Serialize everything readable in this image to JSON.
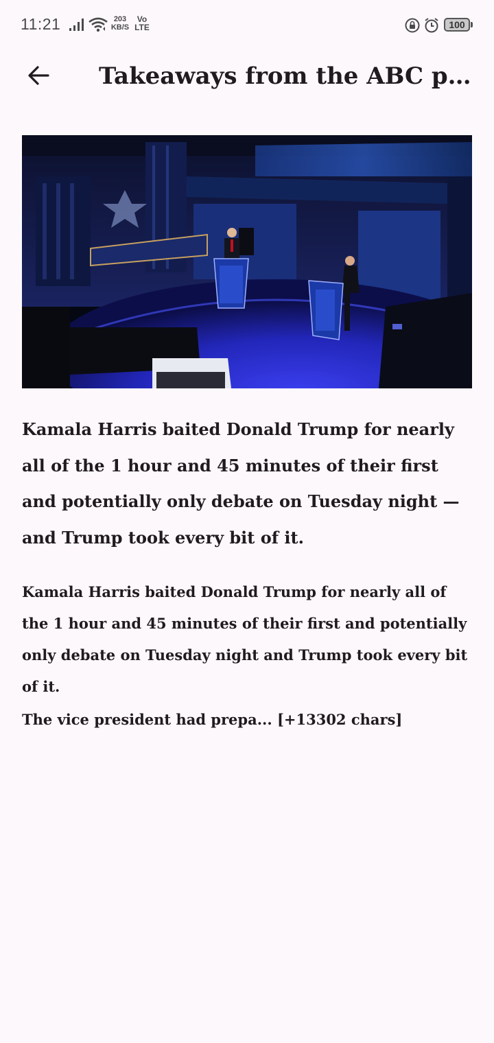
{
  "status_bar": {
    "time": "11:21",
    "net_speed_value": "203",
    "net_speed_unit": "KB/S",
    "volte_top": "Vo",
    "volte_bottom": "LTE",
    "battery": "100"
  },
  "header": {
    "title": "Takeaways from the ABC pr…",
    "back_icon": "arrow-left-icon"
  },
  "article": {
    "image_alt": "Debate stage with two candidates at podiums",
    "lead": "Kamala Harris baited Donald Trump for nearly all of the 1 hour and 45 minutes of their first and potentially only debate on Tuesday night — and Trump took every bit of it.",
    "paragraph_1": "Kamala Harris baited Donald Trump for nearly all of the 1 hour and 45 minutes of their first and potentially only debate on Tuesday night and Trump took every bit of it.",
    "paragraph_2": "The vice president had prepa... [+13302 chars]"
  },
  "colors": {
    "background": "#fdf8fc",
    "text": "#1f1b1f",
    "stage_blue": "#2a2fd0"
  }
}
